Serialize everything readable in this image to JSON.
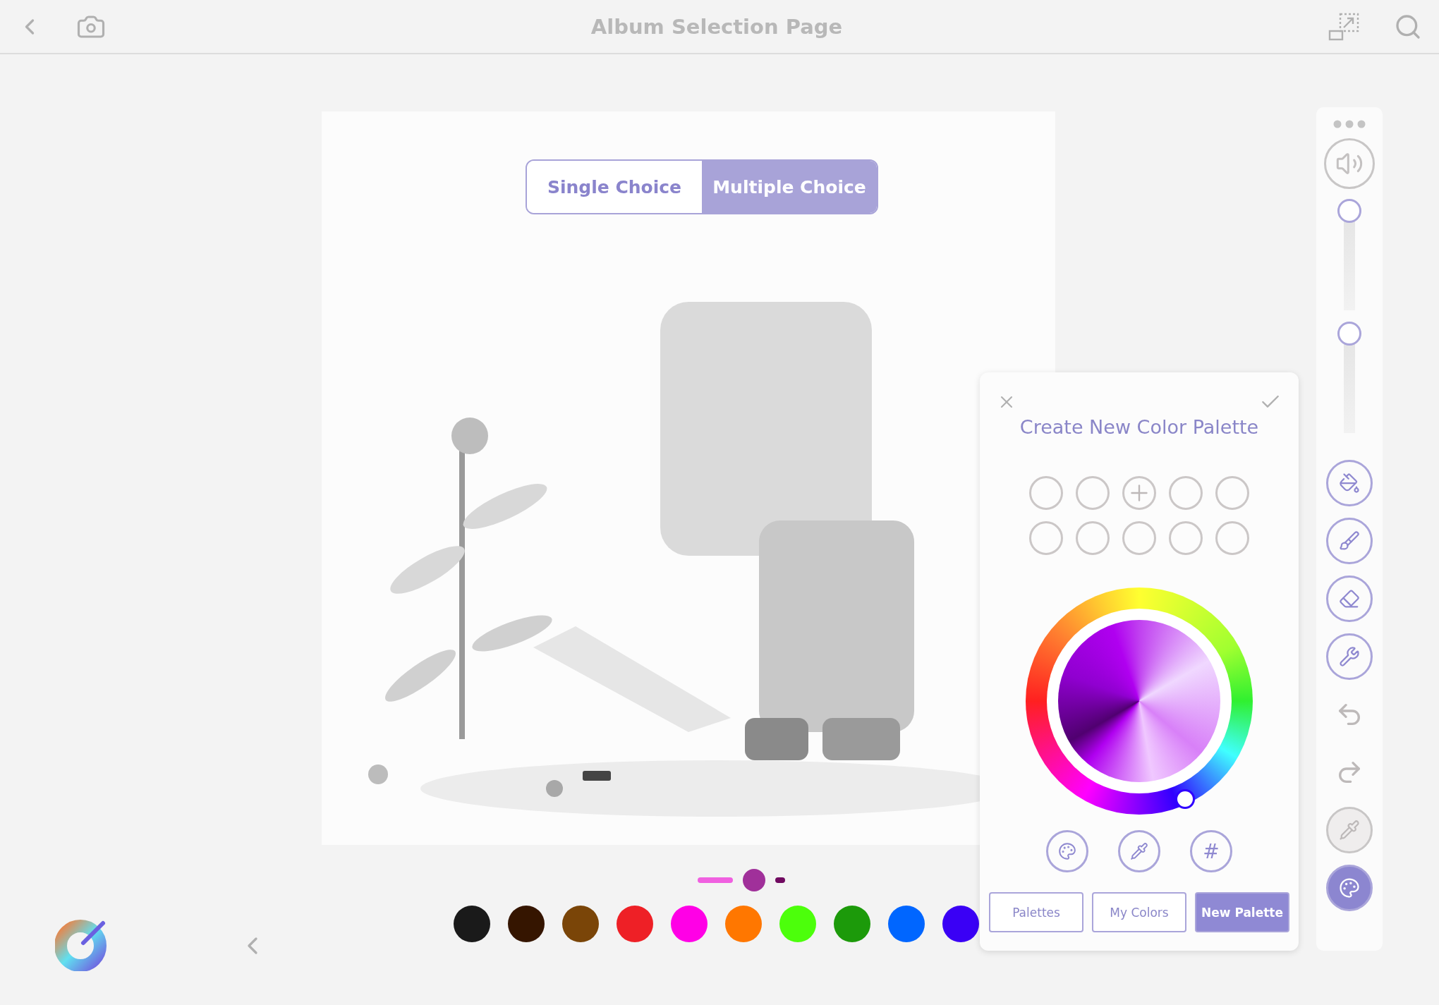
{
  "header": {
    "title": "Album Selection Page"
  },
  "mode_toggle": [
    {
      "label": "Single Choice",
      "selected": false
    },
    {
      "label": "Multiple Choice",
      "selected": true
    }
  ],
  "toolbar": {
    "sliders": [
      {
        "level": 1
      },
      {
        "level": 1
      }
    ],
    "tools": [
      {
        "kind": "bucket",
        "selected": false,
        "disabled": false
      },
      {
        "kind": "brush",
        "selected": false,
        "disabled": false
      },
      {
        "kind": "eraser",
        "selected": false,
        "disabled": false
      },
      {
        "kind": "wrench",
        "selected": false,
        "disabled": false
      },
      {
        "kind": "undo",
        "selected": false,
        "disabled": true
      },
      {
        "kind": "redo",
        "selected": false,
        "disabled": true
      },
      {
        "kind": "dropper",
        "selected": false,
        "disabled": true
      },
      {
        "kind": "palette",
        "selected": true,
        "disabled": false
      }
    ]
  },
  "brush_sizes": [
    {
      "color": "#f060e0",
      "selected": false
    },
    {
      "color": "#a0309a",
      "selected": true
    },
    {
      "color": "#700a60",
      "selected": false
    }
  ],
  "swatches": [
    {
      "color": "#1a1a1a"
    },
    {
      "color": "#351500"
    },
    {
      "color": "#7a4508"
    },
    {
      "color": "#ee2026"
    },
    {
      "color": "#ff00e6"
    },
    {
      "color": "#ff7700"
    },
    {
      "color": "#4cff0b"
    },
    {
      "color": "#1c9a0a"
    },
    {
      "color": "#0066ff"
    },
    {
      "color": "#3a00f5"
    }
  ],
  "palette_panel": {
    "title": "Create New Color Palette",
    "slots": [
      {
        "kind": "empty"
      },
      {
        "kind": "empty"
      },
      {
        "kind": "add"
      },
      {
        "kind": "empty"
      },
      {
        "kind": "empty"
      },
      {
        "kind": "empty"
      },
      {
        "kind": "empty"
      },
      {
        "kind": "empty"
      },
      {
        "kind": "empty"
      },
      {
        "kind": "empty"
      }
    ],
    "picker_modes": [
      {
        "kind": "palette"
      },
      {
        "kind": "dropper"
      },
      {
        "kind": "hex",
        "label": "#"
      }
    ],
    "tabs": [
      {
        "label": "Palettes",
        "selected": false
      },
      {
        "label": "My Colors",
        "selected": false
      },
      {
        "label": "New Palette",
        "selected": true
      }
    ]
  }
}
